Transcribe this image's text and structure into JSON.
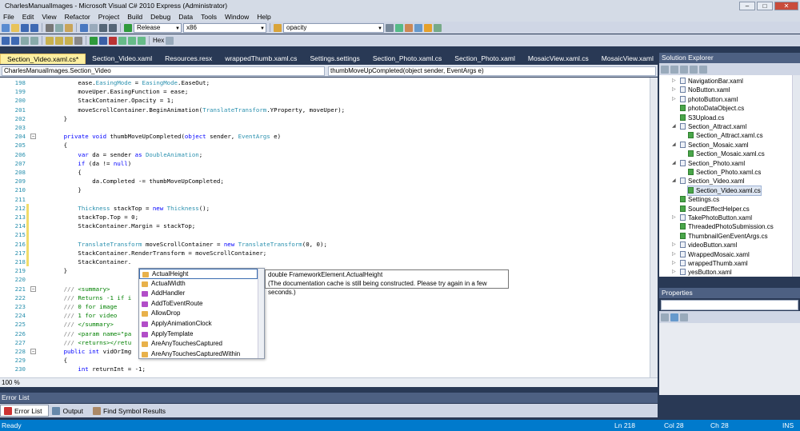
{
  "window": {
    "title": "CharlesManualImages - Microsoft Visual C# 2010 Express (Administrator)",
    "min": "–",
    "max": "□",
    "close": "✕"
  },
  "menu": [
    "File",
    "Edit",
    "View",
    "Refactor",
    "Project",
    "Build",
    "Debug",
    "Data",
    "Tools",
    "Window",
    "Help"
  ],
  "toolbar": {
    "config": "Release",
    "platform": "x86",
    "find": "opacity",
    "hex": "Hex"
  },
  "tabs": [
    "Section_Video.xaml.cs*",
    "Section_Video.xaml",
    "Resources.resx",
    "wrappedThumb.xaml.cs",
    "Settings.settings",
    "Section_Photo.xaml.cs",
    "Section_Photo.xaml",
    "MosaicView.xaml.cs",
    "MosaicView.xaml"
  ],
  "nav": {
    "left": "CharlesManualImages.Section_Video",
    "right": "thumbMoveUpCompleted(object sender, EventArgs e)"
  },
  "code": [
    {
      "n": "198",
      "t": "            ease.EasingMode = EasingMode.EaseOut;"
    },
    {
      "n": "199",
      "t": "            moveUper.EasingFunction = ease;"
    },
    {
      "n": "200",
      "t": "            StackContainer.Opacity = 1;"
    },
    {
      "n": "201",
      "t": "            moveScrollContainer.BeginAnimation(TranslateTransform.YProperty, moveUper);"
    },
    {
      "n": "202",
      "t": "        }"
    },
    {
      "n": "203",
      "t": ""
    },
    {
      "n": "204",
      "t": "        private void thumbMoveUpCompleted(object sender, EventArgs e)"
    },
    {
      "n": "205",
      "t": "        {"
    },
    {
      "n": "206",
      "t": "            var da = sender as DoubleAnimation;"
    },
    {
      "n": "207",
      "t": "            if (da != null)"
    },
    {
      "n": "208",
      "t": "            {"
    },
    {
      "n": "209",
      "t": "                da.Completed -= thumbMoveUpCompleted;"
    },
    {
      "n": "210",
      "t": "            }"
    },
    {
      "n": "211",
      "t": ""
    },
    {
      "n": "212",
      "t": "            Thickness stackTop = new Thickness();"
    },
    {
      "n": "213",
      "t": "            stackTop.Top = 0;"
    },
    {
      "n": "214",
      "t": "            StackContainer.Margin = stackTop;"
    },
    {
      "n": "215",
      "t": ""
    },
    {
      "n": "216",
      "t": "            TranslateTransform moveScrollContainer = new TranslateTransform(0, 0);"
    },
    {
      "n": "217",
      "t": "            StackContainer.RenderTransform = moveScrollContainer;"
    },
    {
      "n": "218",
      "t": "            StackContainer."
    },
    {
      "n": "219",
      "t": "        }"
    },
    {
      "n": "220",
      "t": ""
    },
    {
      "n": "221",
      "t": "        /// <summary>"
    },
    {
      "n": "222",
      "t": "        /// Returns -1 if i"
    },
    {
      "n": "223",
      "t": "        /// 0 for image"
    },
    {
      "n": "224",
      "t": "        /// 1 for video"
    },
    {
      "n": "225",
      "t": "        /// </summary>"
    },
    {
      "n": "226",
      "t": "        /// <param name=\"pa"
    },
    {
      "n": "227",
      "t": "        /// <returns></retu"
    },
    {
      "n": "228",
      "t": "        public int vidOrImg"
    },
    {
      "n": "229",
      "t": "        {"
    },
    {
      "n": "230",
      "t": "            int returnInt = -1;"
    }
  ],
  "intellisense": [
    "ActualHeight",
    "ActualWidth",
    "AddHandler",
    "AddToEventRoute",
    "AllowDrop",
    "ApplyAnimationClock",
    "ApplyTemplate",
    "AreAnyTouchesCaptured",
    "AreAnyTouchesCapturedWithin"
  ],
  "tooltip": {
    "line1": "double FrameworkElement.ActualHeight",
    "line2": "(The documentation cache is still being constructed. Please try again in a few seconds.)"
  },
  "zoom": "100 %",
  "solution_explorer": {
    "title": "Solution Explorer",
    "items": [
      {
        "label": "NavigationBar.xaml",
        "lvl": 0,
        "exp": "▷"
      },
      {
        "label": "NoButton.xaml",
        "lvl": 0,
        "exp": "▷"
      },
      {
        "label": "photoButton.xaml",
        "lvl": 0,
        "exp": "▷"
      },
      {
        "label": "photoDataObject.cs",
        "lvl": 0,
        "exp": ""
      },
      {
        "label": "S3Upload.cs",
        "lvl": 0,
        "exp": ""
      },
      {
        "label": "Section_Attract.xaml",
        "lvl": 0,
        "exp": "◢"
      },
      {
        "label": "Section_Attract.xaml.cs",
        "lvl": 1,
        "exp": ""
      },
      {
        "label": "Section_Mosaic.xaml",
        "lvl": 0,
        "exp": "◢"
      },
      {
        "label": "Section_Mosaic.xaml.cs",
        "lvl": 1,
        "exp": ""
      },
      {
        "label": "Section_Photo.xaml",
        "lvl": 0,
        "exp": "◢"
      },
      {
        "label": "Section_Photo.xaml.cs",
        "lvl": 1,
        "exp": ""
      },
      {
        "label": "Section_Video.xaml",
        "lvl": 0,
        "exp": "◢"
      },
      {
        "label": "Section_Video.xaml.cs",
        "lvl": 1,
        "exp": ""
      },
      {
        "label": "Settings.cs",
        "lvl": 0,
        "exp": ""
      },
      {
        "label": "SoundEffectHelper.cs",
        "lvl": 0,
        "exp": ""
      },
      {
        "label": "TakePhotoButton.xaml",
        "lvl": 0,
        "exp": "▷"
      },
      {
        "label": "ThreadedPhotoSubmission.cs",
        "lvl": 0,
        "exp": ""
      },
      {
        "label": "ThumbnailGenEventArgs.cs",
        "lvl": 0,
        "exp": ""
      },
      {
        "label": "videoButton.xaml",
        "lvl": 0,
        "exp": "▷"
      },
      {
        "label": "WrappedMosaic.xaml",
        "lvl": 0,
        "exp": "▷"
      },
      {
        "label": "wrappedThumb.xaml",
        "lvl": 0,
        "exp": "▷"
      },
      {
        "label": "yesButton.xaml",
        "lvl": 0,
        "exp": "▷"
      }
    ]
  },
  "properties": {
    "title": "Properties"
  },
  "error_list": {
    "title": "Error List",
    "tabs": [
      "Error List",
      "Output",
      "Find Symbol Results"
    ]
  },
  "status": {
    "ready": "Ready",
    "ln": "Ln 218",
    "col": "Col 28",
    "ch": "Ch 28",
    "ins": "INS"
  }
}
